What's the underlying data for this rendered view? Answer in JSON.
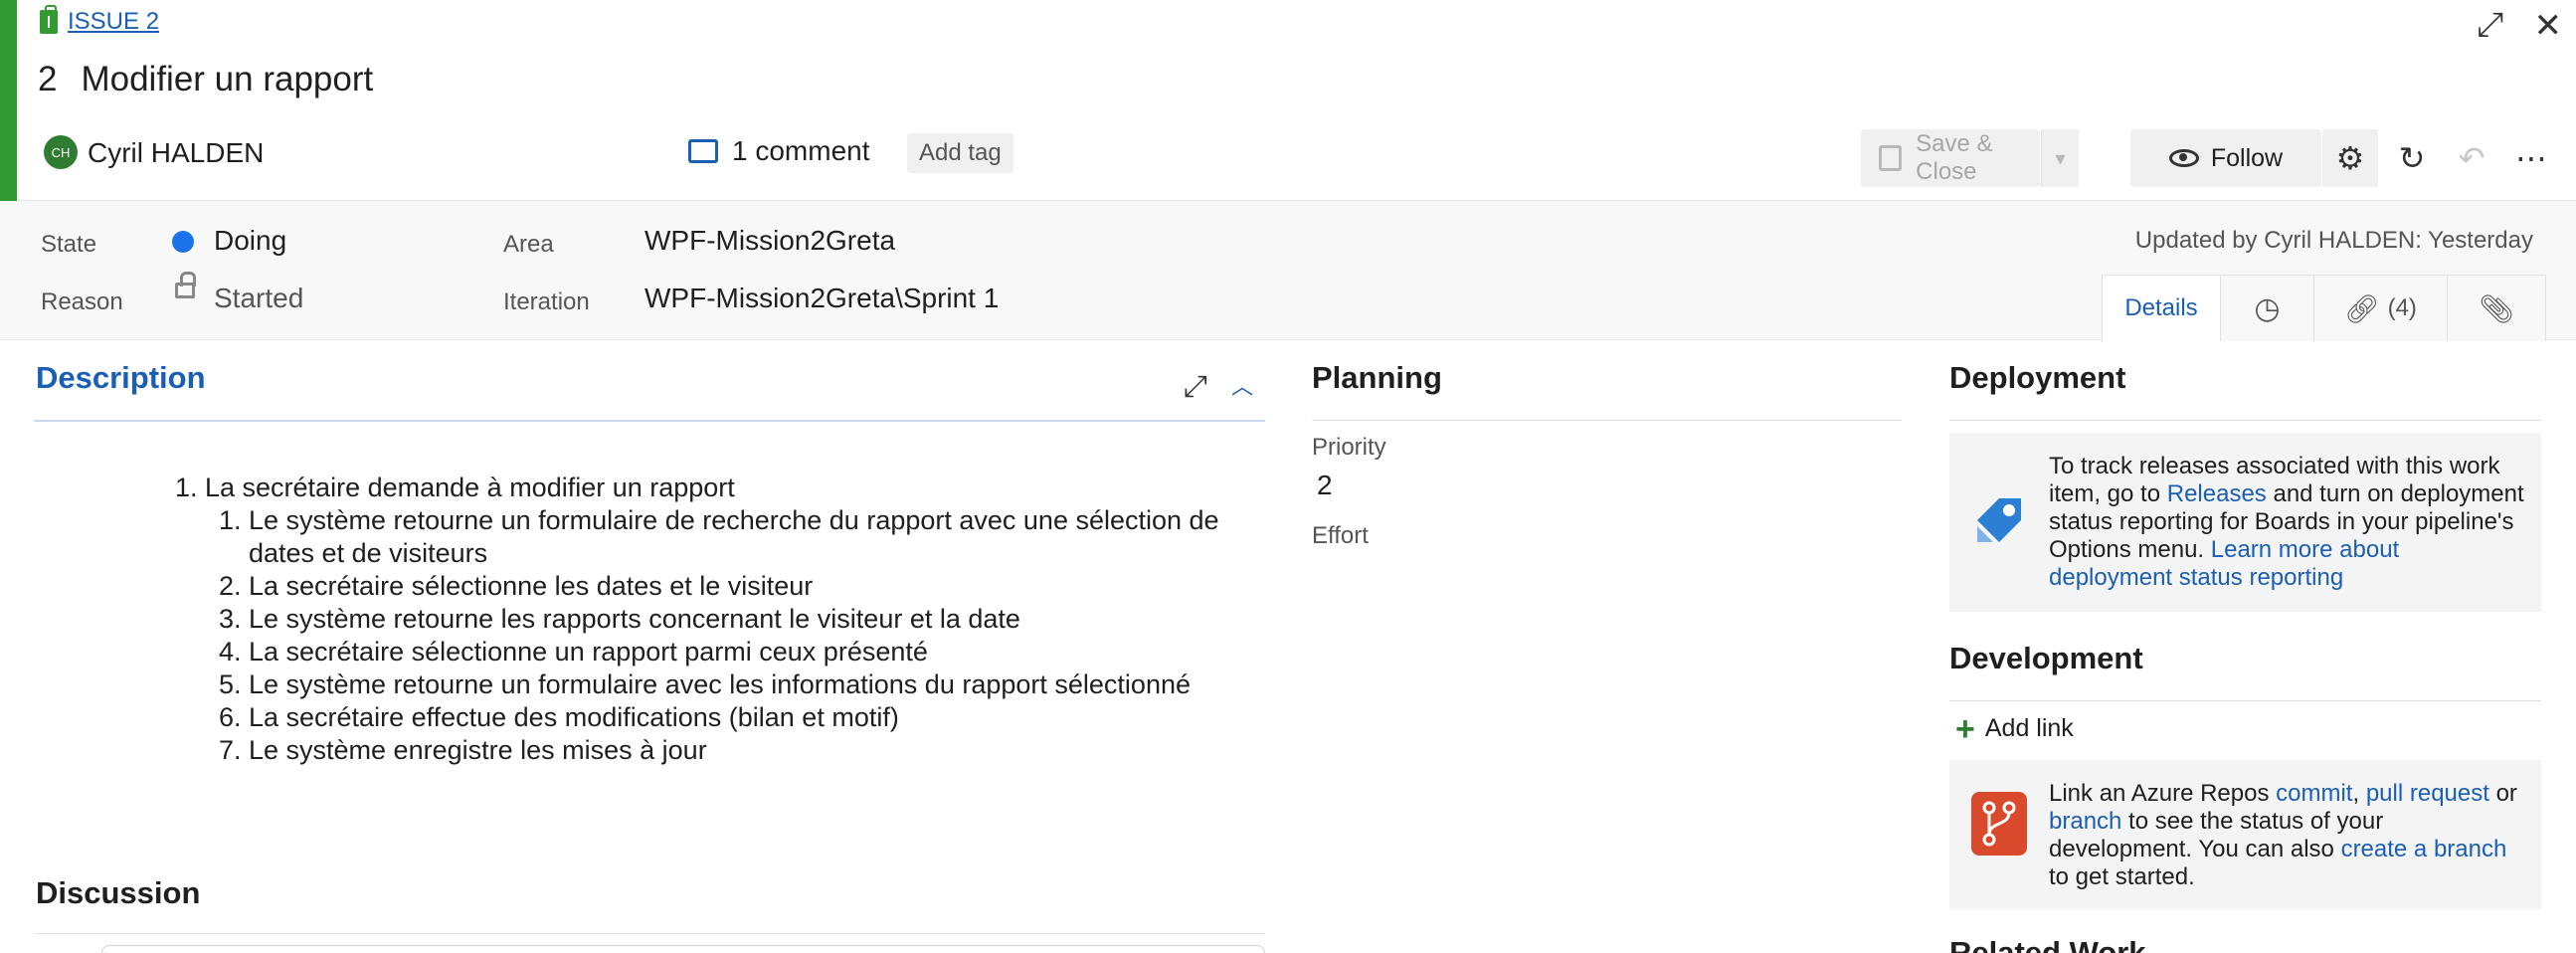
{
  "work_item": {
    "type_label": "ISSUE 2",
    "id": "2",
    "title": "Modifier un rapport",
    "assignee": "Cyril HALDEN",
    "assignee_initials": "CH",
    "comments": "1 comment",
    "add_tag": "Add tag"
  },
  "toolbar": {
    "save_close": "Save & Close",
    "follow": "Follow"
  },
  "fields": {
    "state_label": "State",
    "state_value": "Doing",
    "reason_label": "Reason",
    "reason_value": "Started",
    "area_label": "Area",
    "area_value": "WPF-Mission2Greta",
    "iteration_label": "Iteration",
    "iteration_value": "WPF-Mission2Greta\\Sprint 1",
    "updated": "Updated by Cyril HALDEN: Yesterday"
  },
  "tabs": {
    "details": "Details",
    "links": "(4)"
  },
  "description": {
    "heading": "Description",
    "main_item": "La secrétaire demande à modifier un rapport",
    "steps": [
      "Le système retourne un formulaire de recherche du rapport avec une sélection de dates et de visiteurs",
      "La secrétaire sélectionne les dates et le visiteur",
      "Le système retourne les rapports concernant le visiteur et la date",
      "La secrétaire sélectionne un rapport parmi ceux présenté",
      "Le système retourne un formulaire avec les informations du rapport sélectionné",
      "La secrétaire effectue des modifications (bilan et motif)",
      "Le système enregistre les mises à jour"
    ]
  },
  "discussion": {
    "heading": "Discussion"
  },
  "planning": {
    "heading": "Planning",
    "priority_label": "Priority",
    "priority_value": "2",
    "effort_label": "Effort"
  },
  "deployment": {
    "heading": "Deployment",
    "text_1": "To track releases associated with this work item, go to ",
    "link_releases": "Releases",
    "text_2": " and turn on deployment status reporting for Boards in your pipeline's Options menu. ",
    "link_learn": "Learn more about deployment status reporting"
  },
  "development": {
    "heading": "Development",
    "add_link": "Add link",
    "text_1": "Link an Azure Repos ",
    "link_commit": "commit",
    "comma": ", ",
    "link_pr": "pull request",
    "text_or": " or ",
    "link_branch": "branch",
    "text_2": " to see the status of your development. You can also ",
    "link_create": "create a branch",
    "text_3": " to get started."
  },
  "related": {
    "heading": "Related Work"
  },
  "colors": {
    "accent": "#339933",
    "link": "#1a5fb4",
    "state_doing": "#1a73e8"
  }
}
